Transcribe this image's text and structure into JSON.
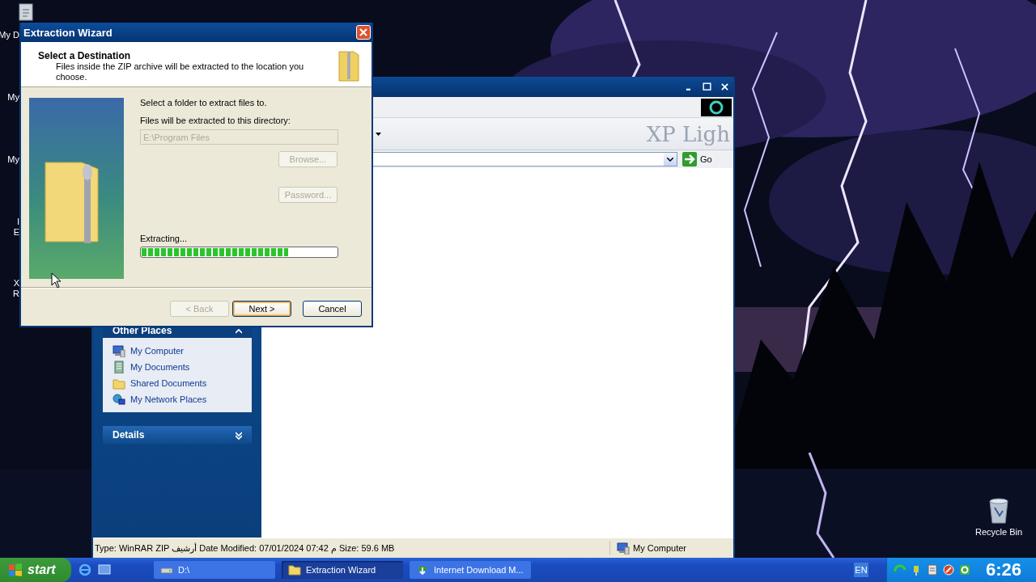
{
  "desktop": {
    "icons": [
      {
        "lines": [
          "My D"
        ]
      },
      {
        "lines": [
          "My"
        ]
      },
      {
        "lines": [
          "My"
        ]
      },
      {
        "lines": [
          "I",
          "E"
        ]
      },
      {
        "lines": [
          "X",
          "R"
        ]
      }
    ],
    "recycle_bin": {
      "label": "Recycle Bin"
    }
  },
  "explorer": {
    "brand": "XP Ligh",
    "go_button": "Go",
    "other_places": {
      "title": "Other Places",
      "expanded": true,
      "items": [
        {
          "label": "My Computer",
          "kind": "computer"
        },
        {
          "label": "My Documents",
          "kind": "documents"
        },
        {
          "label": "Shared Documents",
          "kind": "folder"
        },
        {
          "label": "My Network Places",
          "kind": "network"
        }
      ]
    },
    "details": {
      "title": "Details",
      "expanded": false
    },
    "status_bar": {
      "info": "Type: WinRAR ZIP أرشيف Date Modified: 07/01/2024 07:42 م Size: 59.6 MB",
      "zone": "My Computer"
    }
  },
  "wizard": {
    "title": "Extraction Wizard",
    "heading": "Select a Destination",
    "description": "Files inside the ZIP archive will be extracted to the location you choose.",
    "prompt": "Select a folder to extract files to.",
    "directory_label": "Files will be extracted to this directory:",
    "directory": {
      "value": "E:\\Program Files",
      "disabled": true
    },
    "browse_button": {
      "label": "Browse...",
      "disabled": true
    },
    "password_button": {
      "label": "Password...",
      "disabled": true
    },
    "progress": {
      "label": "Extracting...",
      "level": 0.75
    },
    "buttons": [
      {
        "label": "< Back",
        "disabled": true,
        "default": false
      },
      {
        "label": "Next >",
        "disabled": false,
        "default": true
      },
      {
        "label": "Cancel",
        "disabled": false,
        "default": false
      }
    ]
  },
  "taskbar": {
    "start": "start",
    "tasks": [
      {
        "label": "D:\\",
        "kind": "drive",
        "selected": false
      },
      {
        "label": "Extraction Wizard",
        "kind": "folder",
        "selected": true
      },
      {
        "label": "Internet Download M...",
        "kind": "download",
        "selected": false
      }
    ],
    "language": "EN",
    "clock": "6:26"
  }
}
